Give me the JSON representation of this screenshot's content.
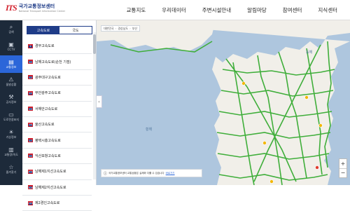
{
  "header": {
    "logo_mark_its": "ITS",
    "logo_title": "국가교통정보센터",
    "logo_sub": "National Transport Information Center",
    "nav": [
      "교통지도",
      "우리데이터",
      "주변시설안내",
      "알림마당",
      "참여센터",
      "지식센터"
    ]
  },
  "sidebar": {
    "items": [
      {
        "label": "검색",
        "icon": "search-icon",
        "glyph": "⌕"
      },
      {
        "label": "CCTV",
        "icon": "cctv-icon",
        "glyph": "▣"
      },
      {
        "label": "교통정보",
        "icon": "traffic-icon",
        "glyph": "▤",
        "active": true
      },
      {
        "label": "돌발상황",
        "icon": "incident-icon",
        "glyph": "⚠"
      },
      {
        "label": "공사정보",
        "icon": "construction-icon",
        "glyph": "⚒"
      },
      {
        "label": "도로전광표지",
        "icon": "sign-icon",
        "glyph": "▭"
      },
      {
        "label": "기상정보",
        "icon": "weather-icon",
        "glyph": "☀"
      },
      {
        "label": "교통량/속도",
        "icon": "chart-icon",
        "glyph": "▥"
      },
      {
        "label": "즐겨찾기",
        "icon": "star-icon",
        "glyph": "☆"
      }
    ]
  },
  "panel": {
    "tabs": [
      "고속도로",
      "국도"
    ],
    "roads": [
      {
        "name": "경부고속도로",
        "num": "1"
      },
      {
        "name": "남해고속도로(순천 기점)",
        "num": "10"
      },
      {
        "name": "광주대구고속도로",
        "num": "12"
      },
      {
        "name": "무안광주고속도로",
        "num": "12"
      },
      {
        "name": "서해안고속도로",
        "num": "15"
      },
      {
        "name": "울산고속도로",
        "num": "16"
      },
      {
        "name": "평택시흥고속도로",
        "num": "17"
      },
      {
        "name": "익산포항고속도로",
        "num": "20"
      },
      {
        "name": "남해제1지선고속도로",
        "num": "102"
      },
      {
        "name": "남해제2지선고속도로",
        "num": "104"
      },
      {
        "name": "제2경인고속도로",
        "num": "110"
      }
    ]
  },
  "map": {
    "breadcrumb": [
      "대한민국",
      "경상남도",
      "부산"
    ],
    "sea_west": "황해",
    "sea_east": "동해",
    "notice_text": "국가교통정보센터 교통상황은 실제와 다를 수 있습니다",
    "notice_link": "바로가기",
    "zoom_in": "+",
    "zoom_out": "−",
    "collapse": "‹",
    "colors": {
      "sea": "#aec6de",
      "land": "#f1efe9",
      "road_free": "#3fae3a",
      "road_slow": "#f2b705",
      "road_jam": "#e03b2e"
    }
  }
}
